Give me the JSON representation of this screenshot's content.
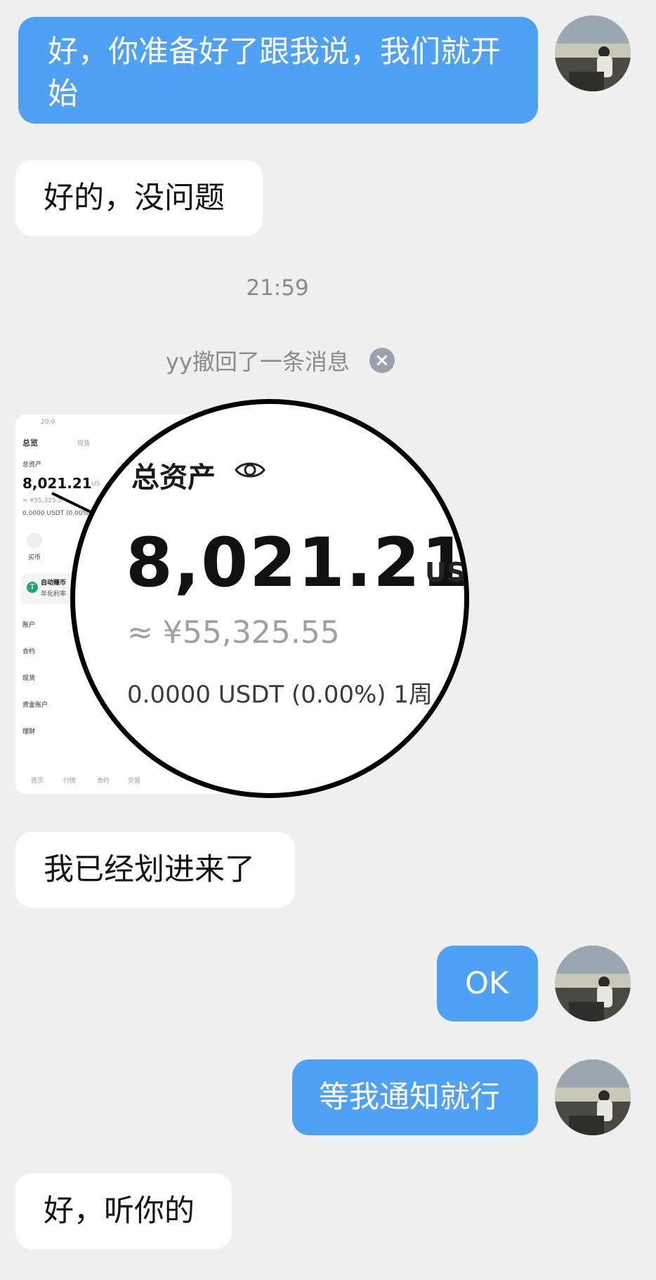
{
  "messages": {
    "m1": "好，你准备好了跟我说，我们就开始",
    "m2": "好的，没问题",
    "time": "21:59",
    "recall": "yy撤回了一条消息",
    "m3": "我已经划进来了",
    "m4": "OK",
    "m5": "等我通知就行",
    "m6": "好，听你的"
  },
  "screenshot": {
    "status_time": "20:0",
    "tab_overview": "总览",
    "tab_spot": "现货",
    "total_assets_label": "总资产",
    "total_assets_value": "8,021.21",
    "unit": "USDT",
    "unit_short": "US",
    "unit_cut": "USI",
    "cny_value": "≈ ¥55,325.55",
    "cny_small": "≈ ¥55,325.5",
    "pnl_text": "0.0000 USDT (0.00%) 1周",
    "pnl_small": "0.0000 USDT (0.00%)",
    "buy_label": "买币",
    "auto_earn": "自动赚币",
    "annual_rate": "年化利率",
    "accounts": [
      "账户",
      "合约",
      "现货",
      "资金账户",
      "理财"
    ],
    "bottom_nav": [
      "首页",
      "行情",
      "合约",
      "交易"
    ]
  },
  "colors": {
    "outgoing_bubble": "#4ea1f5",
    "incoming_bubble": "#ffffff",
    "background": "#efefef"
  }
}
